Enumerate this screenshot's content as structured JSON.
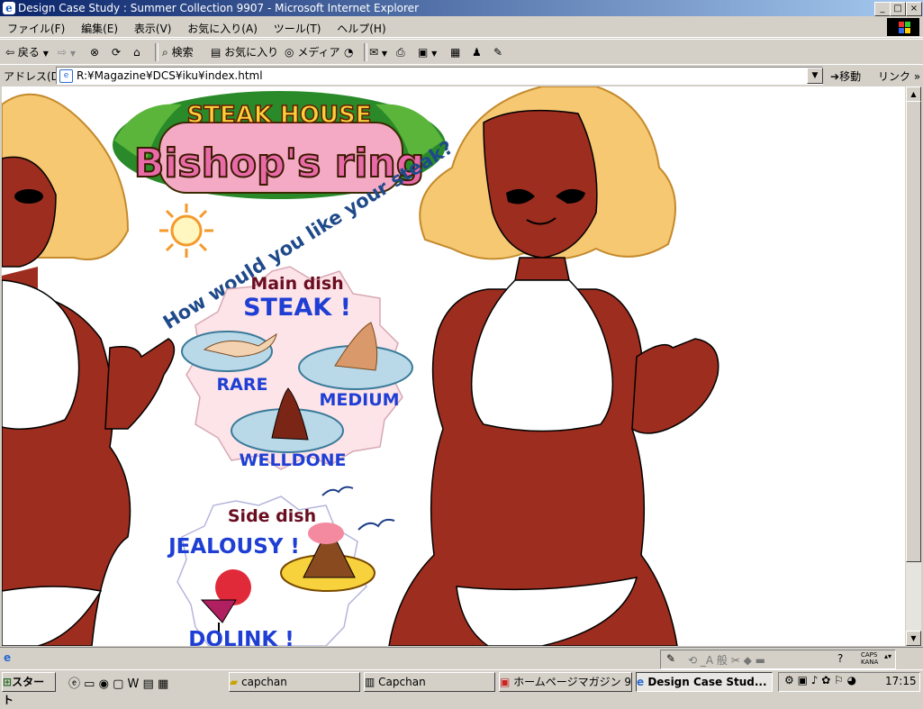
{
  "window": {
    "title": "Design Case Study : Summer Collection 9907 - Microsoft Internet Explorer",
    "minimize": "_",
    "restore": "□",
    "close": "×"
  },
  "menu": {
    "items": [
      "ファイル(F)",
      "編集(E)",
      "表示(V)",
      "お気に入り(A)",
      "ツール(T)",
      "ヘルプ(H)"
    ]
  },
  "toolbar": {
    "back": "戻る",
    "search": "検索",
    "favorites": "お気に入り",
    "media": "メディア"
  },
  "address": {
    "label": "アドレス(D)",
    "url": "R:¥Magazine¥DCS¥iku¥index.html",
    "go": "移動",
    "links": "リンク",
    "links_arrow": "»"
  },
  "page": {
    "logo_top": "STEAK HOUSE",
    "logo_main": "Bishop's ring",
    "question": "How would you like your steak?",
    "main_dish_label": "Main dish",
    "main_dish": "STEAK !",
    "rare": "RARE",
    "medium": "MEDIUM",
    "welldone": "WELLDONE",
    "side_dish_label": "Side dish",
    "side_dish": "JEALOUSY !",
    "drink": "DOLINK !"
  },
  "colors": {
    "skin": "#9c2d1f",
    "hair": "#f6c872",
    "title_blue": "#0a246a",
    "menu_blue": "#1f3fd4",
    "burgundy": "#6b0d20"
  },
  "statusbar": {
    "caps": "CAPS",
    "kana": "KANA"
  },
  "taskbar": {
    "start": "スタート",
    "tasks": [
      "capchan",
      "Capchan",
      "ホームページマガジン 99...",
      "Design Case Stud..."
    ],
    "clock": "17:15"
  }
}
